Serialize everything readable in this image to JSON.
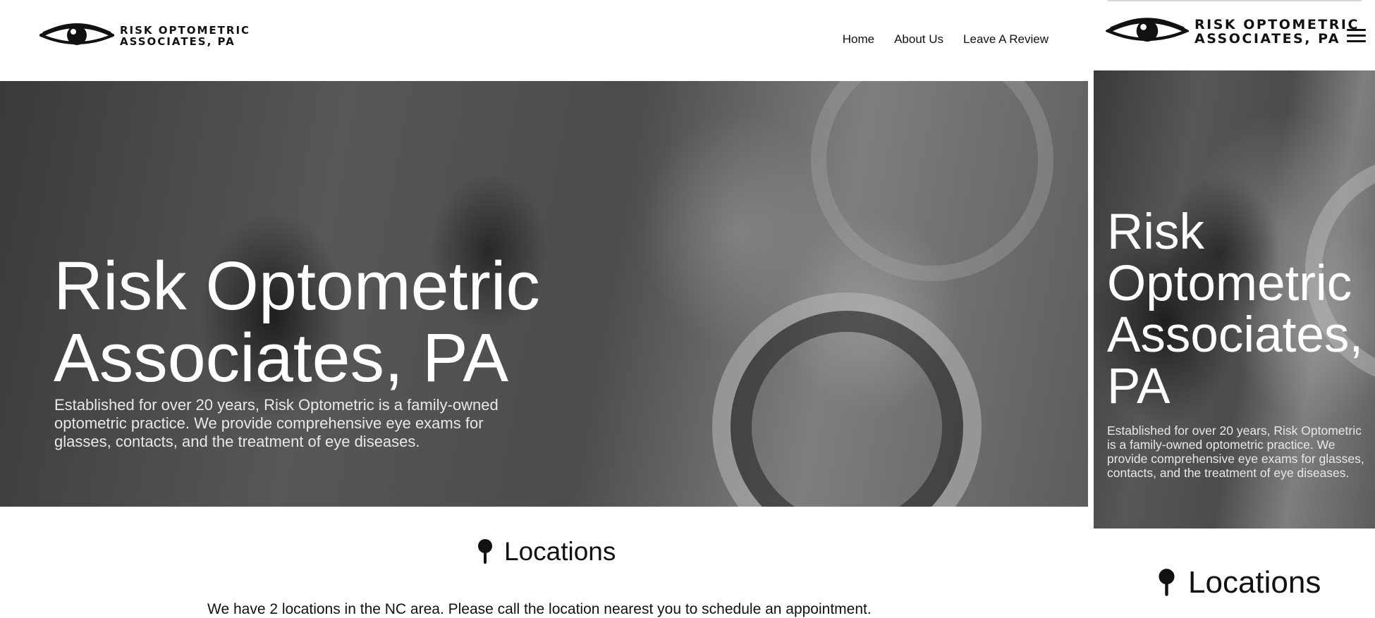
{
  "brand": {
    "line1": "RISK OPTOMETRIC",
    "line2": "ASSOCIATES, PA"
  },
  "nav": {
    "items": [
      {
        "label": "Home"
      },
      {
        "label": "About Us"
      },
      {
        "label": "Leave A Review"
      }
    ]
  },
  "hero": {
    "title_line1": "Risk Optometric",
    "title_line2": "Associates, PA",
    "description": "Established for over 20 years, Risk Optometric is a family-owned optometric practice. We provide comprehensive eye exams for glasses, contacts, and the treatment of eye diseases."
  },
  "mobile_hero": {
    "title_lines": [
      "Risk",
      "Optometric",
      "Associates,",
      "PA"
    ]
  },
  "locations": {
    "heading": "Locations",
    "intro": "We have 2 locations in the NC area. Please call the location nearest you to schedule an appointment."
  },
  "icons": {
    "logo": "eye-icon",
    "locations": "map-pin-icon",
    "menu": "hamburger-menu-icon"
  }
}
